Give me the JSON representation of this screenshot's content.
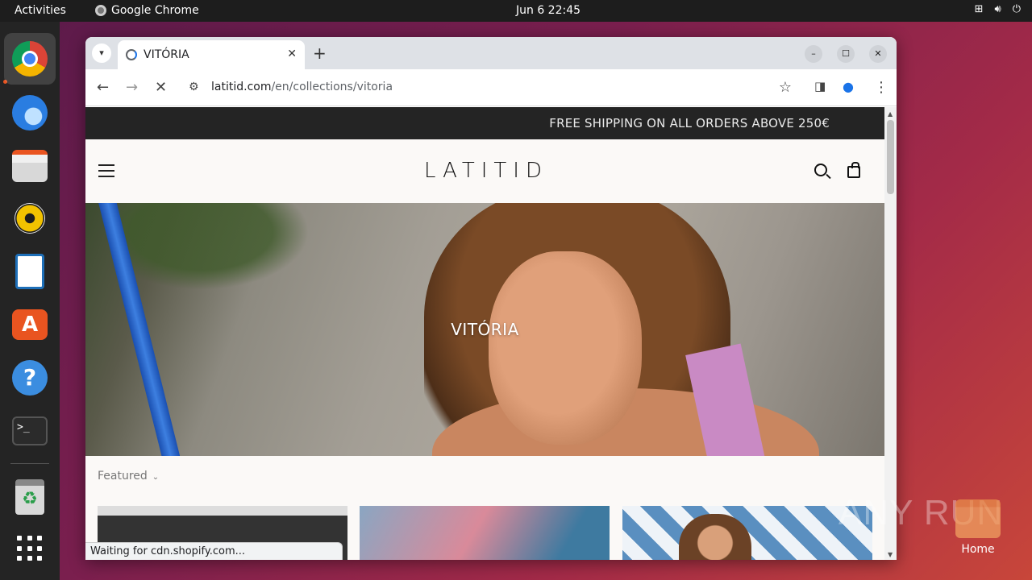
{
  "topbar": {
    "activities": "Activities",
    "app_name": "Google Chrome",
    "clock": "Jun 6  22:45",
    "tray": {
      "network_icon": "network-icon",
      "volume_icon": "volume-icon",
      "power_icon": "power-icon"
    }
  },
  "dock": {
    "items": [
      "chrome",
      "thunderbird",
      "files",
      "rhythmbox",
      "libreoffice-writer",
      "app-center",
      "help",
      "terminal",
      "trash",
      "show-apps"
    ],
    "accent": "#e95420"
  },
  "browser": {
    "tab_title": "VITÓRIA",
    "url_host": "latitid.com",
    "url_path": "/en/collections/vitoria",
    "status": "Waiting for cdn.shopify.com..."
  },
  "page": {
    "announcement": "FREE SHIPPING ON ALL ORDERS ABOVE 250€",
    "logo": "LATITID",
    "hero_title": "VITÓRIA",
    "sort_label": "Featured"
  },
  "desktop": {
    "watermark": "ANY RUN",
    "home_label": "Home"
  }
}
